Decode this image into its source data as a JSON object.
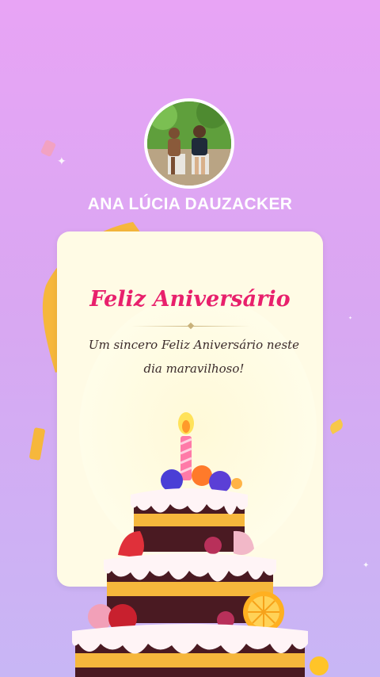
{
  "profile": {
    "name": "ANA LÚCIA DAUZACKER",
    "avatar_icon": "user-photo-icon"
  },
  "card": {
    "title": "Feliz Aniversário",
    "message": "Um sincero Feliz Aniversário neste dia maravilhoso!"
  },
  "colors": {
    "title": "#e8206c",
    "background_top": "#e8a4f5",
    "background_bottom": "#c8b6f5",
    "card": "#fffbe5"
  },
  "decorations": [
    "sparkle-icon",
    "confetti-icon",
    "ribbon-icon",
    "birthday-cake-icon",
    "candle-icon"
  ]
}
